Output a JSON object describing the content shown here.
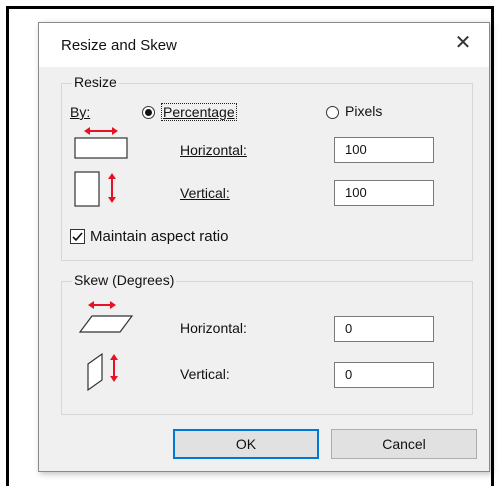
{
  "dialog": {
    "title": "Resize and Skew",
    "close_glyph": "✕"
  },
  "resize": {
    "group_title": "Resize",
    "by_label": "By:",
    "percentage_label": "Percentage",
    "pixels_label": "Pixels",
    "selected_mode": "Percentage",
    "horizontal_label": "Horizontal:",
    "horizontal_value": "100",
    "vertical_label": "Vertical:",
    "vertical_value": "100",
    "maintain_label": "Maintain aspect ratio",
    "maintain_checked": true
  },
  "skew": {
    "group_title": "Skew (Degrees)",
    "horizontal_label": "Horizontal:",
    "horizontal_value": "0",
    "vertical_label": "Vertical:",
    "vertical_value": "0"
  },
  "buttons": {
    "ok_label": "OK",
    "cancel_label": "Cancel"
  },
  "colors": {
    "accent_red": "#e81123",
    "focus_blue": "#0078d7"
  },
  "icons": {
    "resize_horizontal": "resize-horizontal-icon",
    "resize_vertical": "resize-vertical-icon",
    "skew_horizontal": "skew-horizontal-icon",
    "skew_vertical": "skew-vertical-icon",
    "checkmark": "checkmark-icon",
    "close": "close-icon"
  }
}
